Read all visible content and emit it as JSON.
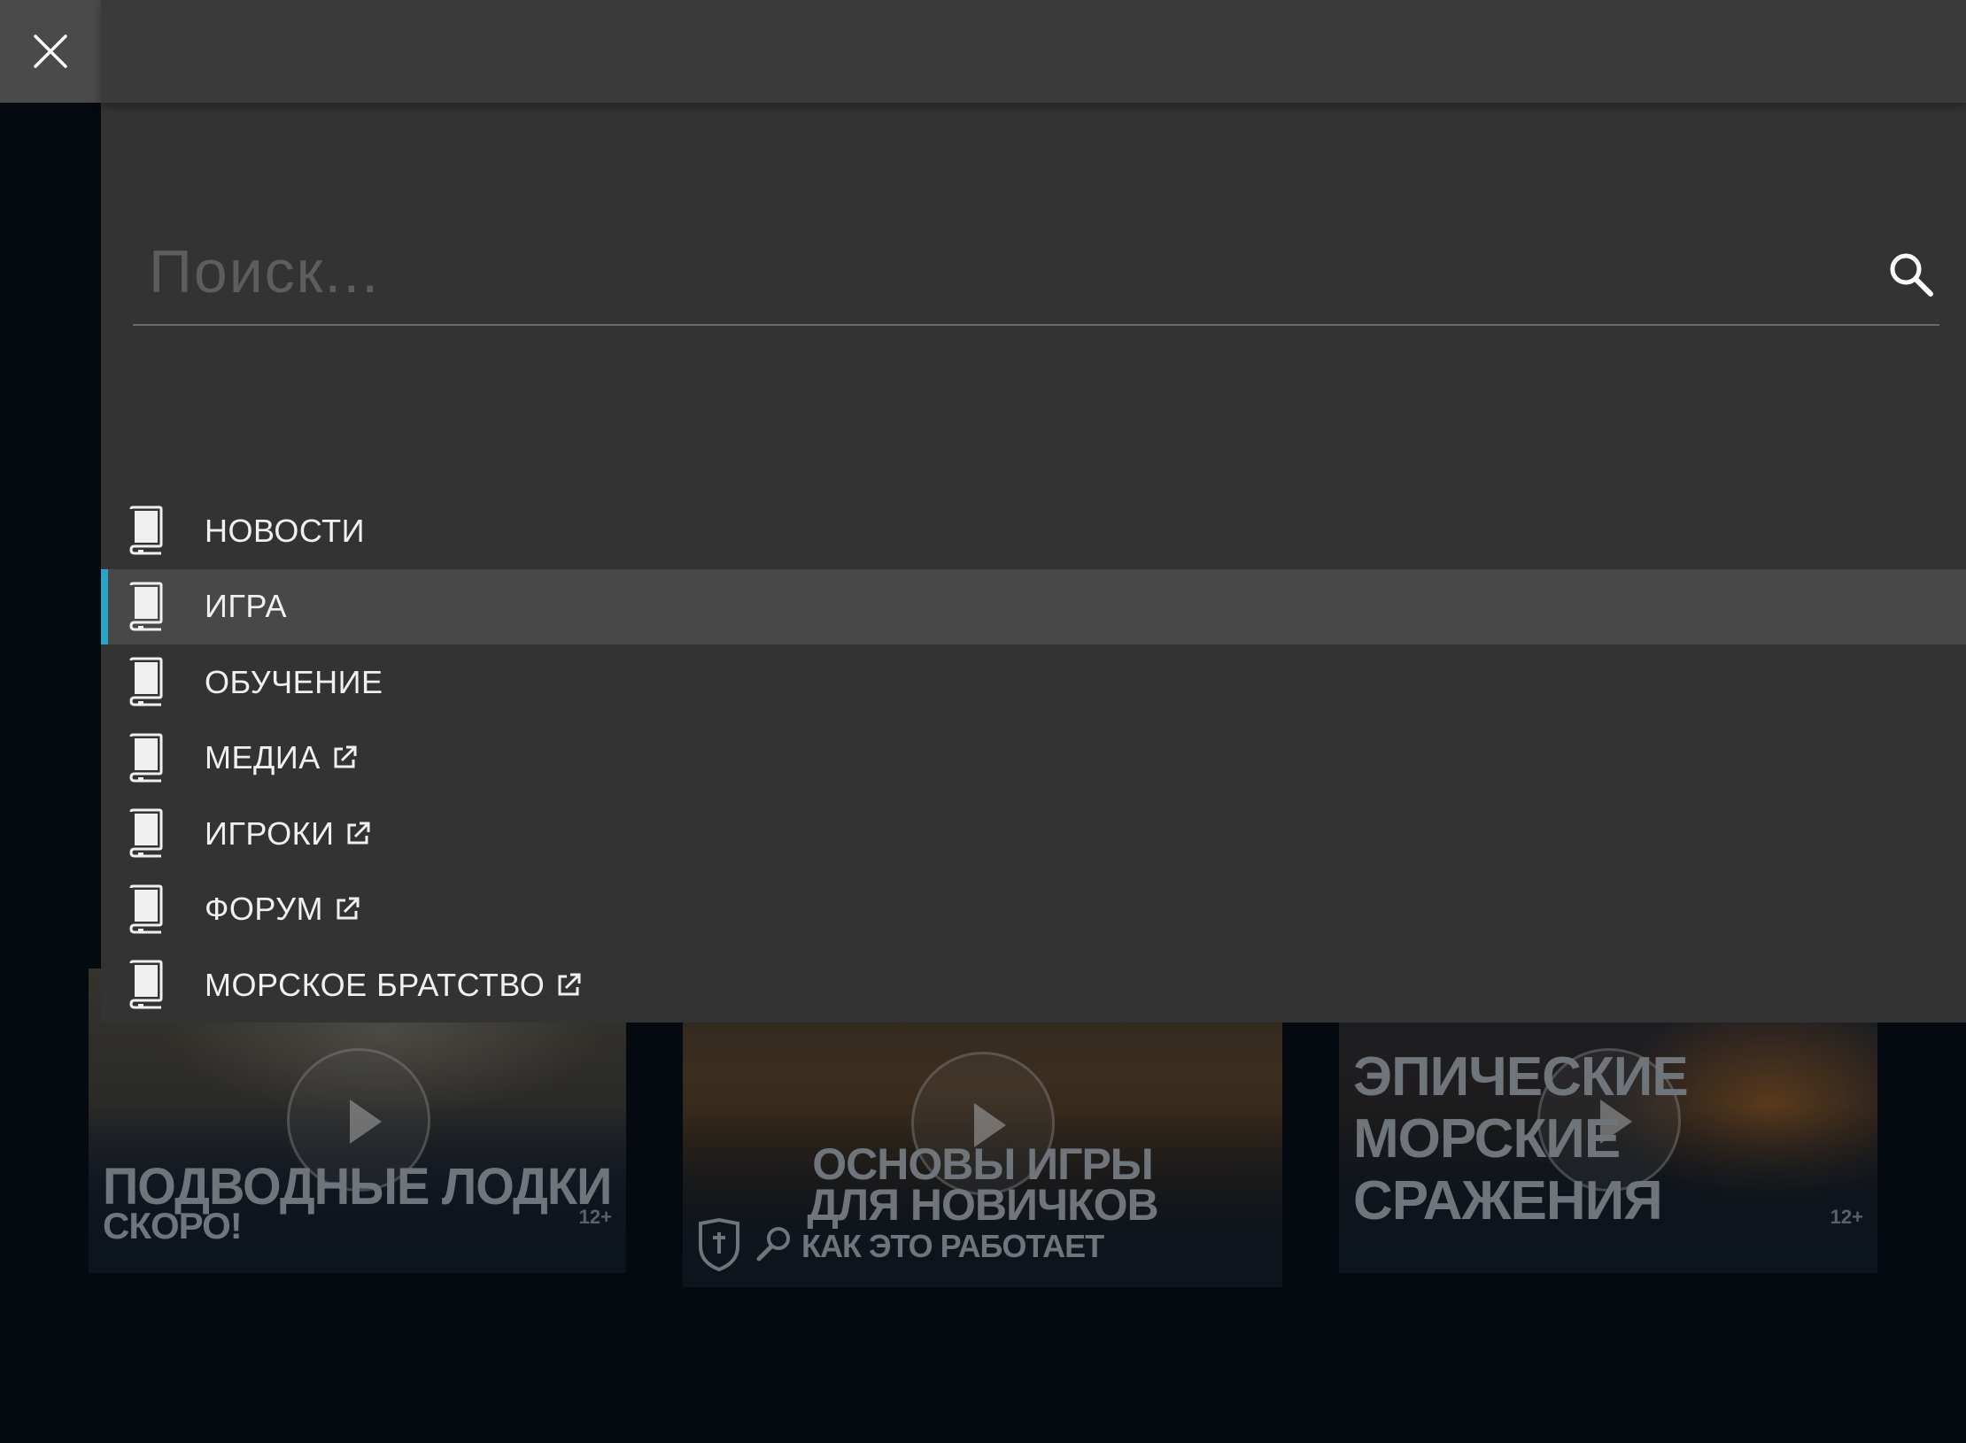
{
  "search": {
    "placeholder": "Поиск..."
  },
  "nav": {
    "items": [
      {
        "label": "НОВОСТИ",
        "external": false,
        "active": false
      },
      {
        "label": "ИГРА",
        "external": false,
        "active": true
      },
      {
        "label": "ОБУЧЕНИЕ",
        "external": false,
        "active": false
      },
      {
        "label": "МЕДИА",
        "external": true,
        "active": false
      },
      {
        "label": "ИГРОКИ",
        "external": true,
        "active": false
      },
      {
        "label": "ФОРУМ",
        "external": true,
        "active": false
      },
      {
        "label": "МОРСКОЕ БРАТСТВО",
        "external": true,
        "active": false
      }
    ]
  },
  "cards": [
    {
      "line1": "ПОДВОДНЫЕ ЛОДКИ",
      "line2": "СКОРО!",
      "age": "12+"
    },
    {
      "line1": "ОСНОВЫ ИГРЫ",
      "line2": "ДЛЯ НОВИЧКОВ",
      "line3": "КАК ЭТО РАБОТАЕТ"
    },
    {
      "line1": "ЭПИЧЕСКИЕ",
      "line2": "МОРСКИЕ",
      "line3": "СРАЖЕНИЯ",
      "age": "12+"
    }
  ],
  "colors": {
    "accent": "#2aa3c7",
    "panel": "#333333",
    "active_row": "#484848"
  },
  "icons": {
    "close": "close-icon",
    "search": "search-icon",
    "nav_item": "book-icon",
    "external": "external-link-icon",
    "play": "play-icon"
  }
}
